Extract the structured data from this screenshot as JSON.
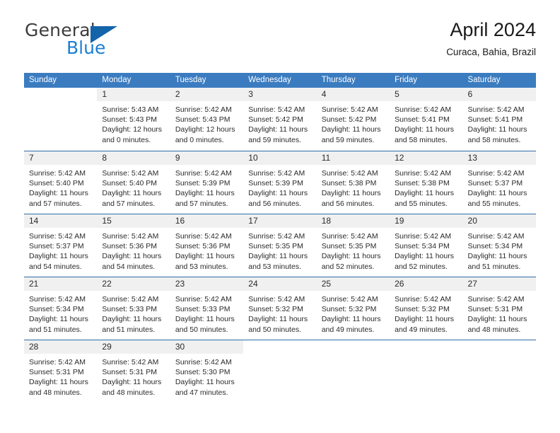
{
  "brand": {
    "name_top": "General",
    "name_bottom": "Blue",
    "triangle_color": "#1464aa",
    "top_color": "#3c3c3c",
    "bottom_color": "#1b7fd4"
  },
  "header": {
    "title": "April 2024",
    "subtitle": "Curaca, Bahia, Brazil"
  },
  "theme": {
    "header_blue": "#3b7cc0",
    "row_divider_blue": "#2e6da8",
    "day_band_gray": "#f0f0f0",
    "text_color": "#2a2a2a"
  },
  "weekdays": [
    "Sunday",
    "Monday",
    "Tuesday",
    "Wednesday",
    "Thursday",
    "Friday",
    "Saturday"
  ],
  "weeks": [
    [
      {
        "day": "",
        "lines": []
      },
      {
        "day": "1",
        "lines": [
          "Sunrise: 5:43 AM",
          "Sunset: 5:43 PM",
          "Daylight: 12 hours",
          "and 0 minutes."
        ]
      },
      {
        "day": "2",
        "lines": [
          "Sunrise: 5:42 AM",
          "Sunset: 5:43 PM",
          "Daylight: 12 hours",
          "and 0 minutes."
        ]
      },
      {
        "day": "3",
        "lines": [
          "Sunrise: 5:42 AM",
          "Sunset: 5:42 PM",
          "Daylight: 11 hours",
          "and 59 minutes."
        ]
      },
      {
        "day": "4",
        "lines": [
          "Sunrise: 5:42 AM",
          "Sunset: 5:42 PM",
          "Daylight: 11 hours",
          "and 59 minutes."
        ]
      },
      {
        "day": "5",
        "lines": [
          "Sunrise: 5:42 AM",
          "Sunset: 5:41 PM",
          "Daylight: 11 hours",
          "and 58 minutes."
        ]
      },
      {
        "day": "6",
        "lines": [
          "Sunrise: 5:42 AM",
          "Sunset: 5:41 PM",
          "Daylight: 11 hours",
          "and 58 minutes."
        ]
      }
    ],
    [
      {
        "day": "7",
        "lines": [
          "Sunrise: 5:42 AM",
          "Sunset: 5:40 PM",
          "Daylight: 11 hours",
          "and 57 minutes."
        ]
      },
      {
        "day": "8",
        "lines": [
          "Sunrise: 5:42 AM",
          "Sunset: 5:40 PM",
          "Daylight: 11 hours",
          "and 57 minutes."
        ]
      },
      {
        "day": "9",
        "lines": [
          "Sunrise: 5:42 AM",
          "Sunset: 5:39 PM",
          "Daylight: 11 hours",
          "and 57 minutes."
        ]
      },
      {
        "day": "10",
        "lines": [
          "Sunrise: 5:42 AM",
          "Sunset: 5:39 PM",
          "Daylight: 11 hours",
          "and 56 minutes."
        ]
      },
      {
        "day": "11",
        "lines": [
          "Sunrise: 5:42 AM",
          "Sunset: 5:38 PM",
          "Daylight: 11 hours",
          "and 56 minutes."
        ]
      },
      {
        "day": "12",
        "lines": [
          "Sunrise: 5:42 AM",
          "Sunset: 5:38 PM",
          "Daylight: 11 hours",
          "and 55 minutes."
        ]
      },
      {
        "day": "13",
        "lines": [
          "Sunrise: 5:42 AM",
          "Sunset: 5:37 PM",
          "Daylight: 11 hours",
          "and 55 minutes."
        ]
      }
    ],
    [
      {
        "day": "14",
        "lines": [
          "Sunrise: 5:42 AM",
          "Sunset: 5:37 PM",
          "Daylight: 11 hours",
          "and 54 minutes."
        ]
      },
      {
        "day": "15",
        "lines": [
          "Sunrise: 5:42 AM",
          "Sunset: 5:36 PM",
          "Daylight: 11 hours",
          "and 54 minutes."
        ]
      },
      {
        "day": "16",
        "lines": [
          "Sunrise: 5:42 AM",
          "Sunset: 5:36 PM",
          "Daylight: 11 hours",
          "and 53 minutes."
        ]
      },
      {
        "day": "17",
        "lines": [
          "Sunrise: 5:42 AM",
          "Sunset: 5:35 PM",
          "Daylight: 11 hours",
          "and 53 minutes."
        ]
      },
      {
        "day": "18",
        "lines": [
          "Sunrise: 5:42 AM",
          "Sunset: 5:35 PM",
          "Daylight: 11 hours",
          "and 52 minutes."
        ]
      },
      {
        "day": "19",
        "lines": [
          "Sunrise: 5:42 AM",
          "Sunset: 5:34 PM",
          "Daylight: 11 hours",
          "and 52 minutes."
        ]
      },
      {
        "day": "20",
        "lines": [
          "Sunrise: 5:42 AM",
          "Sunset: 5:34 PM",
          "Daylight: 11 hours",
          "and 51 minutes."
        ]
      }
    ],
    [
      {
        "day": "21",
        "lines": [
          "Sunrise: 5:42 AM",
          "Sunset: 5:34 PM",
          "Daylight: 11 hours",
          "and 51 minutes."
        ]
      },
      {
        "day": "22",
        "lines": [
          "Sunrise: 5:42 AM",
          "Sunset: 5:33 PM",
          "Daylight: 11 hours",
          "and 51 minutes."
        ]
      },
      {
        "day": "23",
        "lines": [
          "Sunrise: 5:42 AM",
          "Sunset: 5:33 PM",
          "Daylight: 11 hours",
          "and 50 minutes."
        ]
      },
      {
        "day": "24",
        "lines": [
          "Sunrise: 5:42 AM",
          "Sunset: 5:32 PM",
          "Daylight: 11 hours",
          "and 50 minutes."
        ]
      },
      {
        "day": "25",
        "lines": [
          "Sunrise: 5:42 AM",
          "Sunset: 5:32 PM",
          "Daylight: 11 hours",
          "and 49 minutes."
        ]
      },
      {
        "day": "26",
        "lines": [
          "Sunrise: 5:42 AM",
          "Sunset: 5:32 PM",
          "Daylight: 11 hours",
          "and 49 minutes."
        ]
      },
      {
        "day": "27",
        "lines": [
          "Sunrise: 5:42 AM",
          "Sunset: 5:31 PM",
          "Daylight: 11 hours",
          "and 48 minutes."
        ]
      }
    ],
    [
      {
        "day": "28",
        "lines": [
          "Sunrise: 5:42 AM",
          "Sunset: 5:31 PM",
          "Daylight: 11 hours",
          "and 48 minutes."
        ]
      },
      {
        "day": "29",
        "lines": [
          "Sunrise: 5:42 AM",
          "Sunset: 5:31 PM",
          "Daylight: 11 hours",
          "and 48 minutes."
        ]
      },
      {
        "day": "30",
        "lines": [
          "Sunrise: 5:42 AM",
          "Sunset: 5:30 PM",
          "Daylight: 11 hours",
          "and 47 minutes."
        ]
      },
      {
        "day": "",
        "lines": []
      },
      {
        "day": "",
        "lines": []
      },
      {
        "day": "",
        "lines": []
      },
      {
        "day": "",
        "lines": []
      }
    ]
  ]
}
